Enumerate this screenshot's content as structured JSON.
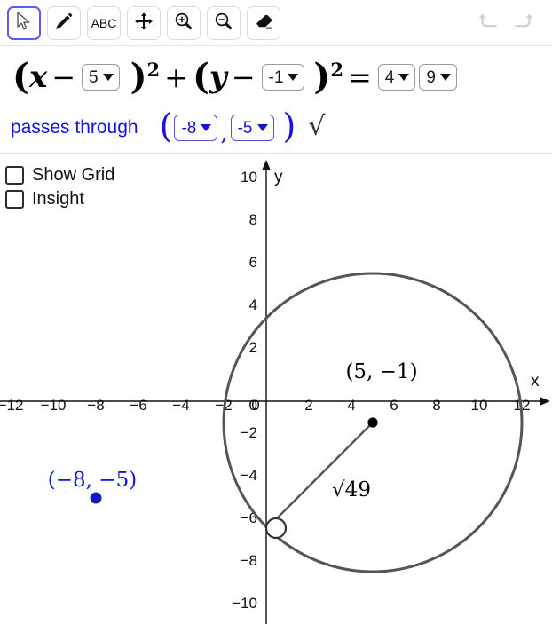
{
  "toolbar": {
    "tools": [
      {
        "name": "select-tool",
        "icon": "cursor-arrow-icon",
        "selected": true
      },
      {
        "name": "pen-tool",
        "icon": "pencil-icon",
        "selected": false
      },
      {
        "name": "text-tool",
        "icon": "abc-icon",
        "label": "ABC",
        "selected": false
      },
      {
        "name": "move-tool",
        "icon": "move-arrows-icon",
        "selected": false
      },
      {
        "name": "zoom-in-tool",
        "icon": "magnifier-plus-icon",
        "selected": false
      },
      {
        "name": "zoom-out-tool",
        "icon": "magnifier-minus-icon",
        "selected": false
      },
      {
        "name": "eraser-tool",
        "icon": "eraser-icon",
        "selected": false
      }
    ],
    "history": [
      {
        "name": "undo-button",
        "icon": "undo-arrow-icon",
        "enabled": false
      },
      {
        "name": "redo-button",
        "icon": "redo-arrow-icon",
        "enabled": false
      }
    ]
  },
  "equation": {
    "open_paren_1": "(",
    "var_x": "x",
    "minus_1": "−",
    "h_value": "5",
    "close_paren_1": ")",
    "exp_1": "2",
    "plus": "+",
    "open_paren_2": "(",
    "var_y": "y",
    "minus_2": "−",
    "k_value": "-1",
    "close_paren_2": ")",
    "exp_2": "2",
    "equals": "=",
    "r2_tens": "4",
    "r2_ones": "9"
  },
  "passes_through": {
    "label": "passes through",
    "open_paren": "(",
    "x_value": "-8",
    "comma": ",",
    "y_value": "-5",
    "close_paren": ")",
    "check_symbol": "√",
    "color": "#1414e0"
  },
  "options": [
    {
      "label": "Show Grid",
      "checked": false
    },
    {
      "label": "Insight",
      "checked": false
    }
  ],
  "chart_data": {
    "type": "scatter",
    "title": "",
    "xlabel": "x",
    "ylabel": "y",
    "xlim": [
      -12.5,
      12.7
    ],
    "ylim": [
      -10.8,
      10.5
    ],
    "grid": false,
    "x_ticks": [
      -12,
      -10,
      -8,
      -6,
      -4,
      -2,
      0,
      2,
      4,
      6,
      8,
      10,
      12
    ],
    "y_ticks": [
      10,
      8,
      6,
      4,
      2,
      0,
      -2,
      -4,
      -6,
      -8,
      -10
    ],
    "x_tick_labels": [
      "−12",
      "−10",
      "−8",
      "−6",
      "−4",
      "−2",
      "0",
      "2",
      "4",
      "6",
      "8",
      "10",
      "12"
    ],
    "y_tick_labels": [
      "10",
      "8",
      "6",
      "4",
      "2",
      "0",
      "−2",
      "−4",
      "−6",
      "−8",
      "−10"
    ],
    "series": [
      {
        "name": "circle",
        "type": "circle",
        "center": [
          5,
          -1
        ],
        "radius": 7,
        "color": "#555555",
        "center_label": "(5, −1)",
        "radius_label": "√49"
      },
      {
        "name": "center-point",
        "type": "point",
        "x": 5,
        "y": -1,
        "style": "filled",
        "color": "#000000"
      },
      {
        "name": "radius-endpoint",
        "type": "point",
        "x": 0,
        "y": -6,
        "style": "open",
        "color": "#333333"
      },
      {
        "name": "given-point",
        "type": "point",
        "x": -8,
        "y": -5,
        "style": "filled",
        "color": "#1414e0",
        "label": "(−8, −5)"
      }
    ],
    "annotations": [
      {
        "text": "(5, −1)",
        "x": 5,
        "y": 0.8,
        "color": "#000000"
      },
      {
        "text": "√49",
        "x": 3.0,
        "y": -3.7,
        "color": "#000000"
      },
      {
        "text": "(−8, −5)",
        "x": -8,
        "y": -4.2,
        "color": "#1414e0"
      }
    ]
  }
}
